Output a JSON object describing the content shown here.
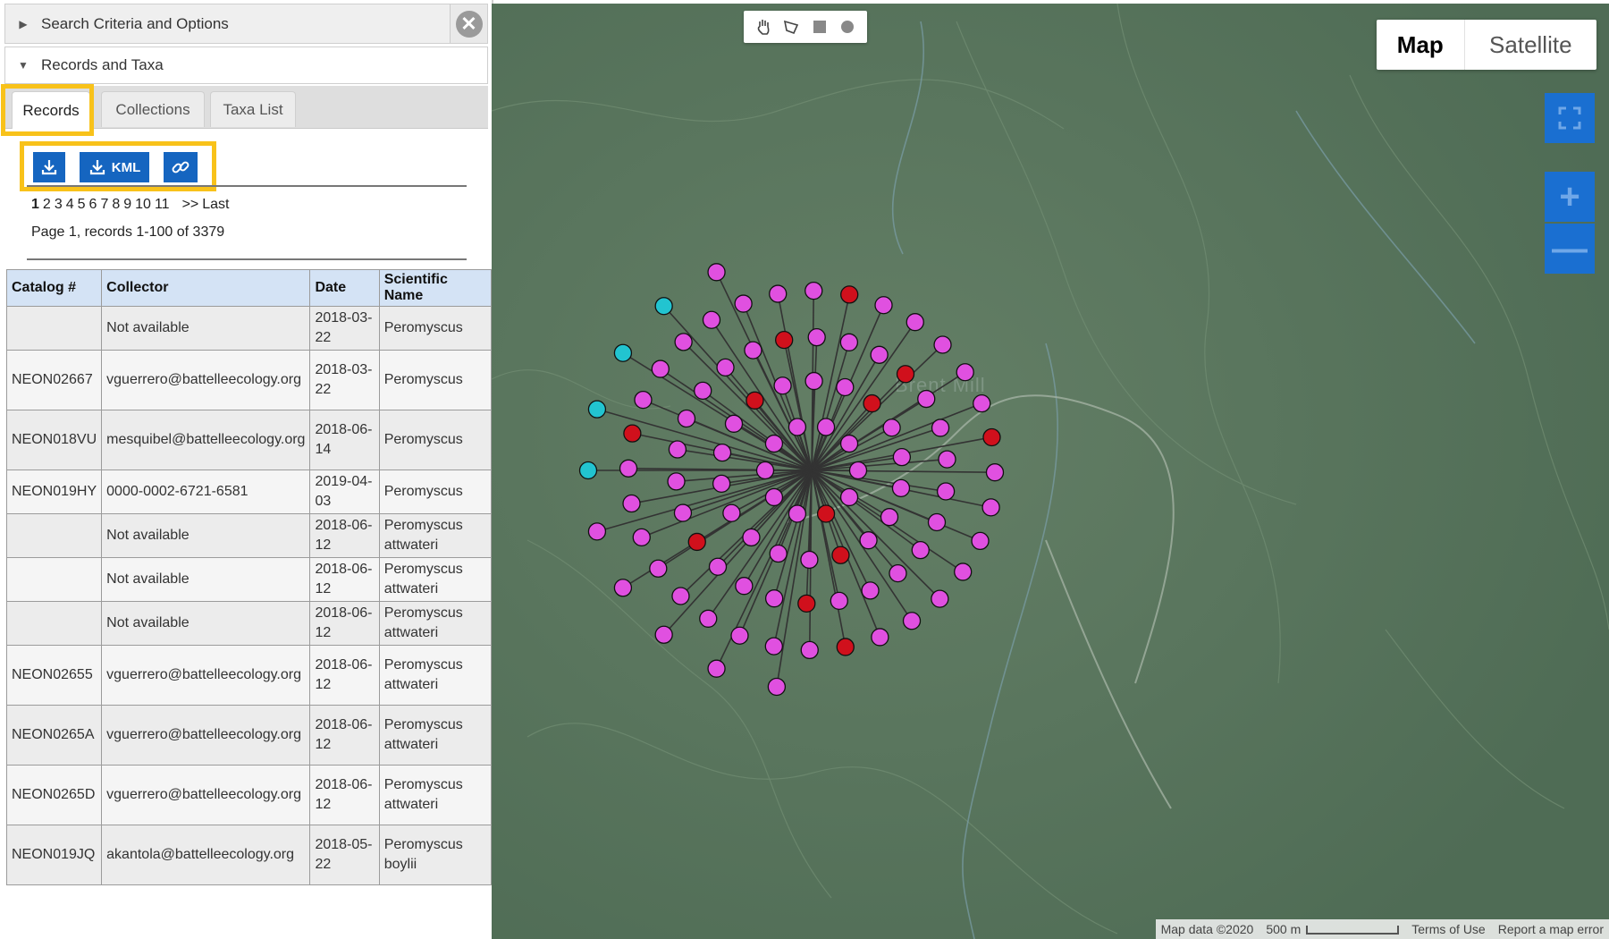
{
  "panel": {
    "search_header": "Search Criteria and Options",
    "records_header": "Records and Taxa",
    "close_icon": "close-icon",
    "tabs": [
      {
        "label": "Records",
        "active": true
      },
      {
        "label": "Collections",
        "active": false
      },
      {
        "label": "Taxa List",
        "active": false
      }
    ],
    "buttons": {
      "download_icon": "download-icon",
      "kml_label": "KML",
      "link_icon": "link-icon"
    },
    "highlight_color": "#f8c21a",
    "pager": {
      "pages": [
        "1",
        "2",
        "3",
        "4",
        "5",
        "6",
        "7",
        "8",
        "9",
        "10",
        "11"
      ],
      "current": "1",
      "next": ">>",
      "last": "Last",
      "info": "Page 1, records 1-100 of 3379"
    }
  },
  "table": {
    "headers": [
      "Catalog #",
      "Collector",
      "Date",
      "Scientific Name"
    ],
    "rows": [
      [
        "",
        "Not available",
        "2018-03-22",
        "Peromyscus"
      ],
      [
        "NEON02667",
        "vguerrero@battelleecology.org",
        "2018-03-22",
        "Peromyscus"
      ],
      [
        "NEON018VU",
        "mesquibel@battelleecology.org",
        "2018-06-14",
        "Peromyscus"
      ],
      [
        "NEON019HY",
        "0000-0002-6721-6581",
        "2019-04-03",
        "Peromyscus"
      ],
      [
        "",
        "Not available",
        "2018-06-12",
        "Peromyscus attwateri"
      ],
      [
        "",
        "Not available",
        "2018-06-12",
        "Peromyscus attwateri"
      ],
      [
        "",
        "Not available",
        "2018-06-12",
        "Peromyscus attwateri"
      ],
      [
        "NEON02655",
        "vguerrero@battelleecology.org",
        "2018-06-12",
        "Peromyscus attwateri"
      ],
      [
        "NEON0265A",
        "vguerrero@battelleecology.org",
        "2018-06-12",
        "Peromyscus attwateri"
      ],
      [
        "NEON0265D",
        "vguerrero@battelleecology.org",
        "2018-06-12",
        "Peromyscus attwateri"
      ],
      [
        "NEON019JQ",
        "akantola@battelleecology.org",
        "2018-05-22",
        "Peromyscus boylii"
      ]
    ]
  },
  "map": {
    "map_type_map": "Map",
    "map_type_satellite": "Satellite",
    "place_label": "Brent Mill",
    "attribution": "Map data ©2020",
    "scale": "500 m",
    "terms": "Terms of Use",
    "report": "Report a map error",
    "colors": {
      "terrain": "#5c7a5f",
      "marker_pink": "#e050e0",
      "marker_red": "#d0101c",
      "marker_cyan": "#22c4d0",
      "control_blue": "#1a6fd1"
    },
    "tools": [
      "hand-icon",
      "polygon-icon",
      "rectangle-icon",
      "circle-icon"
    ]
  }
}
